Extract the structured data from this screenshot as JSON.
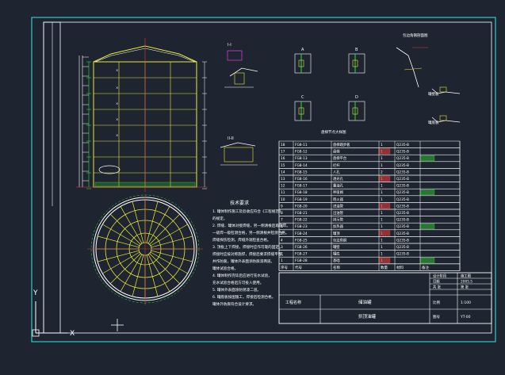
{
  "drawing": {
    "background": "#1e2530",
    "colors": {
      "frame": "#ffffff",
      "cyan_border": "#2ec9c9",
      "yellow": "#e8e83a",
      "green": "#38d838",
      "red": "#e03a3a",
      "magenta": "#e040e0",
      "white": "#ffffff"
    },
    "notes_title": "技术要求",
    "notes": [
      "1. 罐体制作施工及验收应符合《工程规范》",
      "   的规定。",
      "2. 焊缝、罐体对接焊缝，另一侧清根后再施焊。",
      "   一级焊一级检测合格，另一侧清根并检测合格。",
      "   焊缝探伤检测，焊缝外观检查合格。",
      "3. 顶板上下焊接，焊接时应作可靠的固定，",
      "   焊接时应按对称施焊，焊接后要求焊缝平整，",
      "   并作防腐，罐体外表面涂防腐漆两道。",
      "   罐体试验合格。",
      "4. 罐体制作完毕后应进行充水试验，",
      "   充水试验合格后方可投入使用。",
      "5. 罐体外表面涂防锈漆二道。",
      "6. 罐底板按图施工，焊接后检测合格。",
      "   罐体外防腐符合设计要求。"
    ],
    "bom_rows": [
      [
        "18",
        "FG8-11",
        "盘梯踏步板",
        "1",
        "Q235-B",
        ""
      ],
      [
        "17",
        "FG8-12",
        "盘梯",
        "1",
        "Q235-B",
        ""
      ],
      [
        "16",
        "FG8-13",
        "盘梯平台",
        "1",
        "Q235-B",
        ""
      ],
      [
        "15",
        "FG8-14",
        "栏杆",
        "1",
        "Q235-B",
        ""
      ],
      [
        "14",
        "FG8-15",
        "人孔",
        "2",
        "Q235-B",
        ""
      ],
      [
        "13",
        "FG8-16",
        "透光孔",
        "1",
        "Q235-B",
        ""
      ],
      [
        "12",
        "FG8-17",
        "量油孔",
        "1",
        "Q235-B",
        ""
      ],
      [
        "11",
        "FG8-18",
        "呼吸阀",
        "1",
        "Q235-B",
        ""
      ],
      [
        "10",
        "FG8-19",
        "阻火器",
        "1",
        "Q235-B",
        ""
      ],
      [
        "9",
        "FG8-20",
        "进油管",
        "1",
        "Q235-B",
        ""
      ],
      [
        "8",
        "FG8-21",
        "出油管",
        "1",
        "Q235-B",
        ""
      ],
      [
        "7",
        "FG8-22",
        "排污管",
        "1",
        "Q235-B",
        ""
      ],
      [
        "6",
        "FG8-23",
        "加热器",
        "1",
        "Q235-B",
        ""
      ],
      [
        "5",
        "FG8-24",
        "罐顶",
        "1",
        "Q235-B",
        ""
      ],
      [
        "4",
        "FG8-25",
        "包边角钢",
        "1",
        "Q235-B",
        ""
      ],
      [
        "3",
        "FG8-26",
        "罐壁",
        "1",
        "Q235-B",
        ""
      ],
      [
        "2",
        "FG8-27",
        "罐底",
        "1",
        "Q235-B",
        ""
      ],
      [
        "1",
        "FG8-28",
        "基础",
        "1",
        "",
        ""
      ]
    ],
    "bom_header": [
      "序号",
      "代号",
      "名称",
      "数量",
      "材料",
      "备注"
    ],
    "title_block": {
      "project_label": "工程名称",
      "drawing_title": "储油罐",
      "drawing_subtitle": "拱顶油罐",
      "scale_label": "比例",
      "scale_value": "1:100",
      "sheet_label": "图号",
      "sheet_value": "YT-00",
      "stage_label": "设计阶段",
      "stage_value": "施工图",
      "date_label": "日期",
      "date_value": "2005.5",
      "page_label": "共 张",
      "page_value": "第 张"
    },
    "detail_labels": {
      "a": "I-I",
      "b": "II-II",
      "c": "A",
      "d": "B",
      "e": "C",
      "f": "D",
      "g": "盘梯节点大样图",
      "h": "包边角钢剖面图",
      "i": "罐壁板",
      "j": "罐底板"
    },
    "ucs": {
      "y_label": "Y",
      "x_label": "X"
    }
  }
}
